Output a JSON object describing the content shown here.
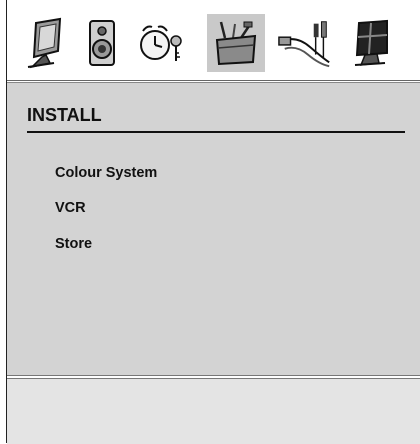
{
  "icon_bar": {
    "icons": [
      {
        "name": "picture-monitor-icon"
      },
      {
        "name": "speaker-icon"
      },
      {
        "name": "alarm-clock-keys-icon"
      },
      {
        "name": "toolbox-icon",
        "selected": true
      },
      {
        "name": "connectors-icon"
      },
      {
        "name": "feature-monitor-icon"
      }
    ]
  },
  "panel": {
    "title": "INSTALL",
    "items": [
      {
        "label": "Colour System"
      },
      {
        "label": "VCR"
      },
      {
        "label": "Store"
      }
    ]
  },
  "colors": {
    "panel_bg": "#d3d3d3",
    "selected_icon_bg": "#c9c9c9",
    "footer_bg": "#e4e4e4",
    "text": "#111111"
  }
}
